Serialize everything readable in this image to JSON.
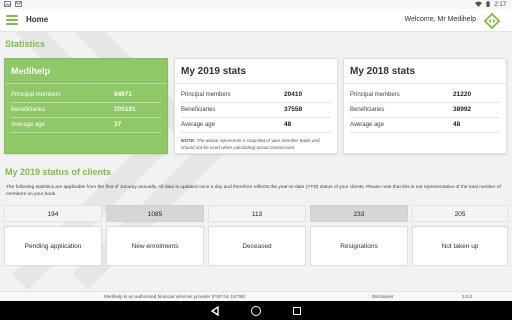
{
  "status_bar": {
    "left_icons": [
      "photo-icon",
      "mail-icon"
    ],
    "time": "2:17",
    "right_icons": [
      "wifi-icon",
      "battery-icon"
    ]
  },
  "app_bar": {
    "title": "Home",
    "welcome": "Welcome, Mr Medihelp",
    "logo_icon": "medihelp-logo-icon"
  },
  "statistics": {
    "heading": "Statistics",
    "cards": [
      {
        "title": "Medihelp",
        "rows": [
          {
            "label": "Principal members",
            "value": "94071"
          },
          {
            "label": "Beneficiaries",
            "value": "205191"
          },
          {
            "label": "Average age",
            "value": "37"
          }
        ]
      },
      {
        "title": "My 2019 stats",
        "rows": [
          {
            "label": "Principal members",
            "value": "20410"
          },
          {
            "label": "Beneficiaries",
            "value": "37558"
          },
          {
            "label": "Average age",
            "value": "48"
          }
        ],
        "note_bold": "NOTE:",
        "note": "The above represents a snapshot of your member totals and should not be used when calculating actual commission."
      },
      {
        "title": "My 2018 stats",
        "rows": [
          {
            "label": "Principal members",
            "value": "21220"
          },
          {
            "label": "Beneficiaries",
            "value": "38992"
          },
          {
            "label": "Average age",
            "value": "48"
          }
        ]
      }
    ]
  },
  "clients": {
    "heading": "My 2019 status of clients",
    "intro": "The following statistics are applicable from the first of January annually. All data is updated once a day and therefore reflects the year-to-date (YTD) status of your clients. Please note that this is not representative of the total number of members on your book.",
    "stats": [
      {
        "count": "194",
        "label": "Pending application"
      },
      {
        "count": "1085",
        "label": "New enrolments"
      },
      {
        "count": "113",
        "label": "Deceased"
      },
      {
        "count": "233",
        "label": "Resignations"
      },
      {
        "count": "205",
        "label": "Not taken up"
      }
    ]
  },
  "footer": {
    "disclaimer_text": "Medihelp is an authorised financial services provider (FSP No 15738)",
    "disclaimer_link": "Disclaimer",
    "version": "3.0.2"
  },
  "colors": {
    "accent": "#7ac143",
    "card_green": "#8fc866"
  }
}
